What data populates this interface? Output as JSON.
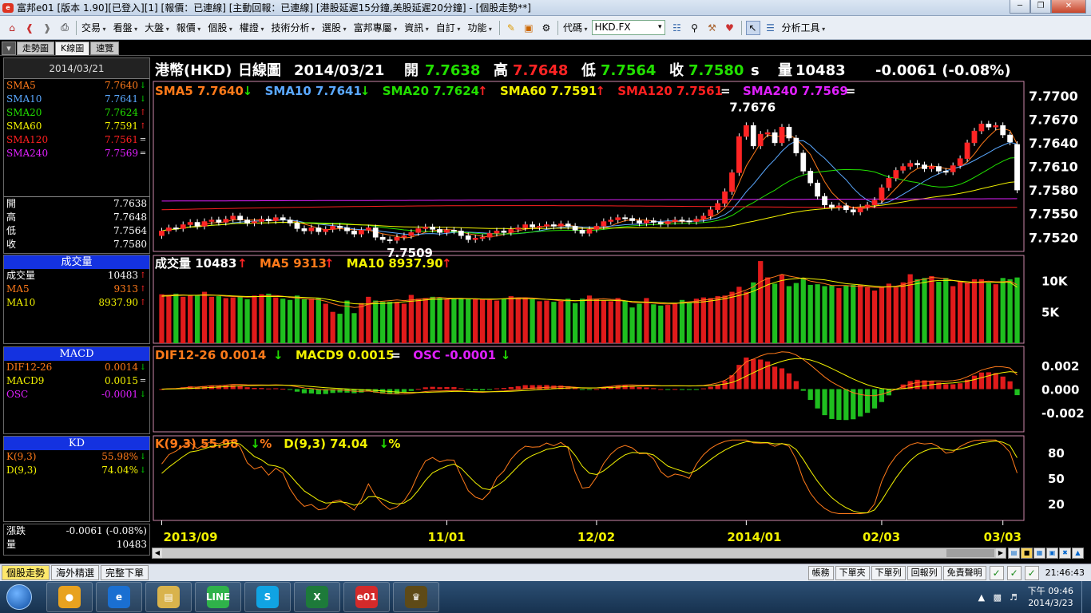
{
  "window": {
    "title": "富邦e01 [版本 1.90][已登入][1] [報價：已連線] [主動回報：已連線] [港股延遲15分鐘,美股延遲20分鐘] - [個股走勢**]"
  },
  "menu": {
    "items": [
      "交易",
      "看盤",
      "大盤",
      "報價",
      "個股",
      "權證",
      "技術分析",
      "選股",
      "富邦專屬",
      "資訊",
      "自訂",
      "功能"
    ],
    "code_label": "代碼",
    "code_value": "HKD.FX",
    "analysis_tools": "分析工具"
  },
  "page_tabs": [
    "走勢圖",
    "K線圖",
    "速覽"
  ],
  "left": {
    "date": "2014/03/21",
    "sma": [
      {
        "name": "SMA5",
        "value": "7.7640",
        "dir": "down",
        "color": "#ff7a1a"
      },
      {
        "name": "SMA10",
        "value": "7.7641",
        "dir": "down",
        "color": "#5aa8ff"
      },
      {
        "name": "SMA20",
        "value": "7.7624",
        "dir": "up",
        "color": "#22e000"
      },
      {
        "name": "SMA60",
        "value": "7.7591",
        "dir": "up",
        "color": "#f2f200"
      },
      {
        "name": "SMA120",
        "value": "7.7561",
        "dir": "eq",
        "color": "#ff2020"
      },
      {
        "name": "SMA240",
        "value": "7.7569",
        "dir": "eq",
        "color": "#e020ff"
      }
    ],
    "ohlc": [
      {
        "name": "開",
        "value": "7.7638"
      },
      {
        "name": "高",
        "value": "7.7648"
      },
      {
        "name": "低",
        "value": "7.7564"
      },
      {
        "name": "收",
        "value": "7.7580"
      }
    ],
    "volume": {
      "header": "成交量",
      "rows": [
        {
          "name": "成交量",
          "value": "10483",
          "dir": "up",
          "color": "#ffffff"
        },
        {
          "name": "MA5",
          "value": "9313",
          "dir": "up",
          "color": "#ff7a1a"
        },
        {
          "name": "MA10",
          "value": "8937.90",
          "dir": "up",
          "color": "#f2f200"
        }
      ]
    },
    "macd": {
      "header": "MACD",
      "rows": [
        {
          "name": "DIF12-26",
          "value": "0.0014",
          "dir": "down",
          "color": "#ff7a1a"
        },
        {
          "name": "MACD9",
          "value": "0.0015",
          "dir": "eq",
          "color": "#f2f200"
        },
        {
          "name": "OSC",
          "value": "-0.0001",
          "dir": "down",
          "color": "#e020ff"
        }
      ]
    },
    "kd": {
      "header": "KD",
      "rows": [
        {
          "name": "K(9,3)",
          "value": "55.98%",
          "dir": "down",
          "color": "#ff7a1a"
        },
        {
          "name": "D(9,3)",
          "value": "74.04%",
          "dir": "down",
          "color": "#f2f200"
        }
      ]
    },
    "change": {
      "label": "漲跌",
      "value": "-0.0061 (-0.08%)"
    },
    "qty": {
      "label": "量",
      "value": "10483"
    }
  },
  "header": {
    "name": "港幣(HKD)",
    "period": "日線圖",
    "date": "2014/03/21",
    "open_label": "開",
    "open": "7.7638",
    "high_label": "高",
    "high": "7.7648",
    "low_label": "低",
    "low": "7.7564",
    "close_label": "收",
    "close": "7.7580",
    "s": "s",
    "vol_label": "量",
    "vol": "10483",
    "change": "-0.0061 (-0.08%)"
  },
  "chart_data": {
    "type": "candlestick",
    "price_panel": {
      "legend": [
        {
          "label": "SMA5 7.7640",
          "dir": "down",
          "color": "#ff7a1a"
        },
        {
          "label": "SMA10 7.7641",
          "dir": "down",
          "color": "#5aa8ff"
        },
        {
          "label": "SMA20 7.7624",
          "dir": "up",
          "color": "#22e000"
        },
        {
          "label": "SMA60 7.7591",
          "dir": "up",
          "color": "#f2f200"
        },
        {
          "label": "SMA120 7.7561",
          "dir": "eq",
          "color": "#ff2020"
        },
        {
          "label": "SMA240 7.7569",
          "dir": "eq",
          "color": "#e020ff"
        }
      ],
      "y_ticks": [
        "7.7700",
        "7.7670",
        "7.7640",
        "7.7610",
        "7.7580",
        "7.7550",
        "7.7520"
      ],
      "ylim": [
        7.7502,
        7.7718
      ],
      "annotations": [
        {
          "text": "7.7676"
        },
        {
          "text": "7.7509"
        }
      ],
      "close_series": [
        7.7528,
        7.7532,
        7.7531,
        7.7536,
        7.7539,
        7.7534,
        7.754,
        7.7542,
        7.7539,
        7.7543,
        7.7547,
        7.7542,
        7.7538,
        7.754,
        7.7543,
        7.7541,
        7.7545,
        7.7542,
        7.7538,
        7.7531,
        7.7528,
        7.7532,
        7.7527,
        7.753,
        7.7534,
        7.7532,
        7.7528,
        7.7524,
        7.7529,
        7.7532,
        7.752,
        7.7517,
        7.7516,
        7.752,
        7.7522,
        7.7526,
        7.7531,
        7.7533,
        7.753,
        7.7526,
        7.7529,
        7.7528,
        7.7522,
        7.7517,
        7.7519,
        7.752,
        7.7525,
        7.7528,
        7.7526,
        7.753,
        7.7532,
        7.7536,
        7.7533,
        7.7534,
        7.7536,
        7.7534,
        7.7537,
        7.7534,
        7.7529,
        7.7525,
        7.753,
        7.7534,
        7.754,
        7.7542,
        7.7545,
        7.7544,
        7.7541,
        7.7538,
        7.7541,
        7.7539,
        7.7537,
        7.754,
        7.7542,
        7.7541,
        7.754,
        7.7543,
        7.7547,
        7.7555,
        7.7563,
        7.7578,
        7.7602,
        7.7648,
        7.7662,
        7.7636,
        7.7651,
        7.7653,
        7.764,
        7.766,
        7.7646,
        7.7627,
        7.7604,
        7.7589,
        7.7572,
        7.7561,
        7.7558,
        7.756,
        7.7555,
        7.7552,
        7.7558,
        7.7561,
        7.7567,
        7.7583,
        7.7595,
        7.7605,
        7.761,
        7.7614,
        7.7612,
        7.7607,
        7.761,
        7.7604,
        7.7603,
        7.7611,
        7.762,
        7.764,
        7.7655,
        7.7664,
        7.766,
        7.7662,
        7.765,
        7.7641,
        7.758
      ],
      "open_series": [
        7.7522,
        7.7528,
        7.7532,
        7.7531,
        7.7536,
        7.7539,
        7.7534,
        7.754,
        7.7542,
        7.7539,
        7.7543,
        7.7547,
        7.7542,
        7.7538,
        7.754,
        7.7543,
        7.7541,
        7.7545,
        7.7542,
        7.7538,
        7.7531,
        7.7528,
        7.7532,
        7.7527,
        7.753,
        7.7534,
        7.7532,
        7.7528,
        7.7524,
        7.7529,
        7.7532,
        7.752,
        7.7517,
        7.7516,
        7.752,
        7.7522,
        7.7526,
        7.7531,
        7.7533,
        7.753,
        7.7526,
        7.7529,
        7.7528,
        7.7522,
        7.7517,
        7.7519,
        7.752,
        7.7525,
        7.7528,
        7.7526,
        7.753,
        7.7532,
        7.7536,
        7.7533,
        7.7534,
        7.7536,
        7.7534,
        7.7537,
        7.7534,
        7.7529,
        7.7525,
        7.753,
        7.7534,
        7.754,
        7.7542,
        7.7545,
        7.7544,
        7.7541,
        7.7538,
        7.7541,
        7.7539,
        7.7537,
        7.754,
        7.7542,
        7.7541,
        7.754,
        7.7543,
        7.7547,
        7.7555,
        7.7563,
        7.7578,
        7.7602,
        7.7648,
        7.7662,
        7.7636,
        7.7651,
        7.7653,
        7.764,
        7.766,
        7.7646,
        7.7627,
        7.7604,
        7.7589,
        7.7572,
        7.7561,
        7.7558,
        7.756,
        7.7555,
        7.7552,
        7.7558,
        7.7561,
        7.7567,
        7.7583,
        7.7595,
        7.7605,
        7.761,
        7.7614,
        7.7612,
        7.7607,
        7.761,
        7.7604,
        7.7603,
        7.7611,
        7.762,
        7.764,
        7.7655,
        7.7664,
        7.766,
        7.7662,
        7.765,
        7.7638
      ]
    },
    "volume_panel": {
      "legend": [
        {
          "label": "成交量 10483",
          "dir": "up",
          "color": "#ffffff"
        },
        {
          "label": "MA5 9313",
          "dir": "up",
          "color": "#ff7a1a"
        },
        {
          "label": "MA10 8937.90",
          "dir": "up",
          "color": "#f2f200"
        }
      ],
      "y_ticks": [
        "10K",
        "5K"
      ],
      "ylim": [
        0,
        14000
      ],
      "values": [
        7800,
        7600,
        7900,
        7400,
        7700,
        7600,
        8200,
        7400,
        7500,
        7200,
        7300,
        7400,
        7000,
        7600,
        7800,
        7900,
        7300,
        7100,
        6900,
        7600,
        7000,
        7100,
        7200,
        6300,
        5000,
        4700,
        6800,
        4800,
        6400,
        7400,
        6800,
        6600,
        6600,
        6600,
        6300,
        7700,
        7100,
        7200,
        7400,
        7300,
        7000,
        7100,
        7200,
        7100,
        7000,
        7000,
        6900,
        6800,
        7100,
        7500,
        7200,
        7300,
        7000,
        6700,
        6800,
        6600,
        6700,
        7100,
        6400,
        7100,
        7600,
        7000,
        6800,
        6700,
        7200,
        6800,
        5700,
        6300,
        7200,
        6200,
        6000,
        6100,
        6400,
        6900,
        6400,
        7100,
        7300,
        7200,
        7500,
        7600,
        8200,
        9000,
        8200,
        9700,
        13100,
        10500,
        9500,
        10900,
        9100,
        9600,
        10400,
        9300,
        9400,
        9100,
        9200,
        8800,
        9200,
        9300,
        9300,
        8900,
        8400,
        8900,
        9500,
        8900,
        9700,
        11000,
        10200,
        10400,
        10700,
        9800,
        10400,
        9100,
        9800,
        9600,
        10200,
        10200,
        9600,
        9400,
        10400,
        10200,
        10483
      ],
      "ma5": [
        7600,
        7650,
        7700,
        7700,
        7600,
        7650,
        7750,
        7700,
        7600,
        7500,
        7450,
        7400,
        7350,
        7400,
        7500,
        7600,
        7600,
        7500,
        7300,
        7200,
        7100,
        7000,
        6950,
        6700,
        6300,
        6000,
        5900,
        5700,
        5800,
        6200,
        6600,
        6700,
        6800,
        6900,
        6800,
        6900,
        7000,
        7100,
        7200,
        7300,
        7200,
        7150,
        7150,
        7100,
        7050,
        7000,
        6950,
        7000,
        7100,
        7200,
        7250,
        7250,
        7200,
        7100,
        7000,
        6900,
        6750,
        6800,
        6750,
        6850,
        7000,
        7050,
        7100,
        7000,
        6950,
        6800,
        6500,
        6450,
        6500,
        6400,
        6300,
        6250,
        6300,
        6500,
        6600,
        6700,
        6900,
        7000,
        7200,
        7400,
        7700,
        8100,
        8500,
        9000,
        9800,
        10300,
        10600,
        11000,
        10700,
        10500,
        10300,
        9900,
        9700,
        9500,
        9200,
        9200,
        9200,
        9100,
        9100,
        9000,
        8900,
        8900,
        9000,
        9100,
        9300,
        9700,
        10000,
        10200,
        10500,
        10400,
        10300,
        10000,
        9800,
        9600,
        9700,
        9800,
        9900,
        9800,
        9800,
        9900,
        9313
      ],
      "ma10": [
        7500,
        7550,
        7600,
        7650,
        7650,
        7650,
        7650,
        7650,
        7650,
        7600,
        7550,
        7500,
        7450,
        7450,
        7450,
        7450,
        7450,
        7450,
        7400,
        7350,
        7300,
        7250,
        7200,
        7050,
        6850,
        6600,
        6450,
        6300,
        6250,
        6250,
        6300,
        6350,
        6400,
        6500,
        6600,
        6700,
        6800,
        6900,
        7000,
        7000,
        7050,
        7100,
        7100,
        7100,
        7100,
        7050,
        7050,
        7050,
        7100,
        7100,
        7100,
        7100,
        7100,
        7050,
        7000,
        6950,
        6900,
        6850,
        6800,
        6800,
        6850,
        6850,
        6850,
        6850,
        6800,
        6750,
        6650,
        6600,
        6550,
        6500,
        6450,
        6400,
        6400,
        6400,
        6450,
        6500,
        6600,
        6750,
        6900,
        7100,
        7350,
        7600,
        7900,
        8300,
        8800,
        9300,
        9700,
        10000,
        10200,
        10300,
        10400,
        10300,
        10200,
        10100,
        9900,
        9700,
        9500,
        9400,
        9300,
        9200,
        9100,
        9000,
        9000,
        9000,
        9100,
        9300,
        9500,
        9700,
        9900,
        10000,
        10000,
        10000,
        9900,
        9800,
        9700,
        9700,
        9700,
        9700,
        9700,
        9700,
        8937.9
      ]
    },
    "macd_panel": {
      "legend": [
        {
          "label": "DIF12-26 0.0014",
          "dir": "down",
          "color": "#ff7a1a"
        },
        {
          "label": "MACD9 0.0015",
          "dir": "eq",
          "color": "#f2f200"
        },
        {
          "label": "OSC -0.0001",
          "dir": "down",
          "color": "#e020ff"
        }
      ],
      "y_ticks": [
        "0.002",
        "0.000",
        "-0.002"
      ],
      "ylim": [
        -0.0036,
        0.0036
      ]
    },
    "kd_panel": {
      "legend": [
        {
          "label": "K(9,3) 55.98",
          "dir": "down",
          "color": "#ff7a1a",
          "suffix": "%"
        },
        {
          "label": "D(9,3) 74.04",
          "dir": "down",
          "color": "#f2f200",
          "suffix": "%"
        }
      ],
      "y_ticks": [
        "80",
        "50",
        "20"
      ],
      "ylim": [
        0,
        100
      ]
    },
    "x_ticks": [
      "2013/09",
      "11/01",
      "12/02",
      "2014/01",
      "02/03",
      "03/03"
    ]
  },
  "bottom": {
    "tabs": [
      "個股走勢",
      "海外精選",
      "完整下單"
    ],
    "right_buttons": [
      "帳務",
      "下單夾",
      "下單列",
      "回報列",
      "免責聲明"
    ],
    "clock": "21:46:43"
  },
  "taskbar": {
    "apps": [
      {
        "name": "chrome",
        "color": "#e8a21f",
        "label": "●"
      },
      {
        "name": "ie",
        "color": "#1a6fd1",
        "label": "e"
      },
      {
        "name": "explorer",
        "color": "#d9b34c",
        "label": "▤"
      },
      {
        "name": "line",
        "color": "#2fb24a",
        "label": "LINE"
      },
      {
        "name": "skype",
        "color": "#10a3e3",
        "label": "S"
      },
      {
        "name": "excel",
        "color": "#1d7a3a",
        "label": "X"
      },
      {
        "name": "e01",
        "color": "#d42a2a",
        "label": "e01"
      },
      {
        "name": "crown",
        "color": "#5e4a17",
        "label": "♛"
      }
    ],
    "tray_time": "下午 09:46",
    "tray_date": "2014/3/23"
  }
}
